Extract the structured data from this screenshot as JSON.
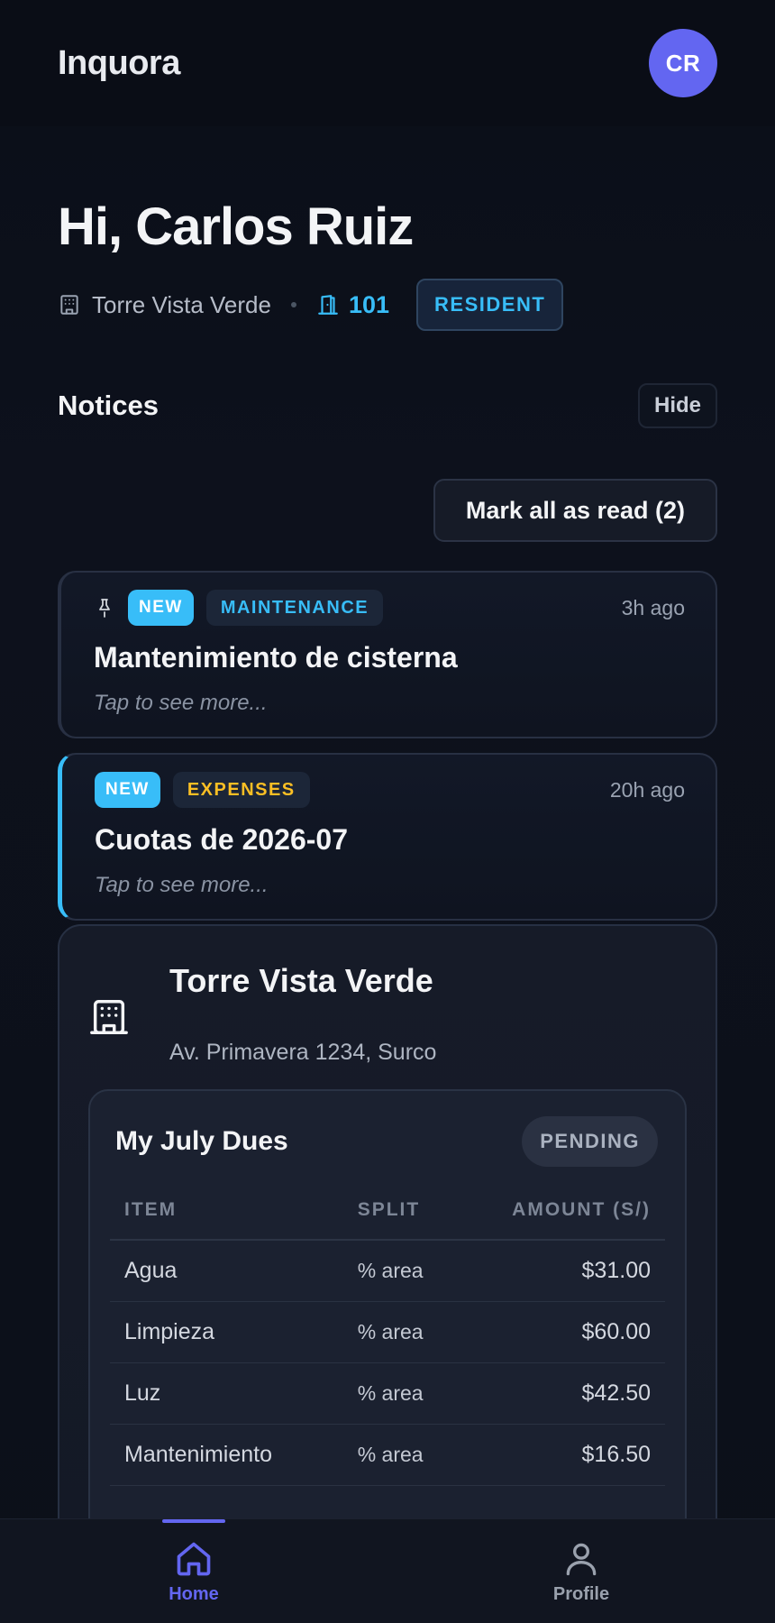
{
  "header": {
    "brand": "Inquora",
    "avatar_initials": "CR"
  },
  "greeting": {
    "title": "Hi, Carlos Ruiz",
    "building": "Torre Vista Verde",
    "unit": "101",
    "role": "RESIDENT"
  },
  "notices": {
    "title": "Notices",
    "hide_label": "Hide",
    "mark_all_label": "Mark all as read (2)",
    "items": [
      {
        "badge": "NEW",
        "category": "MAINTENANCE",
        "time": "3h ago",
        "title": "Mantenimiento de cisterna",
        "subtitle": "Tap to see more...",
        "pinned": true
      },
      {
        "badge": "NEW",
        "category": "EXPENSES",
        "time": "20h ago",
        "title": "Cuotas de 2026-07",
        "subtitle": "Tap to see more...",
        "pinned": false
      }
    ]
  },
  "building_card": {
    "name": "Torre Vista Verde",
    "address": "Av. Primavera 1234, Surco",
    "dues": {
      "title": "My July Dues",
      "status": "PENDING",
      "columns": [
        "ITEM",
        "SPLIT",
        "AMOUNT (S/)"
      ],
      "rows": [
        {
          "item": "Agua",
          "split": "% area",
          "amount": "$31.00"
        },
        {
          "item": "Limpieza",
          "split": "% area",
          "amount": "$60.00"
        },
        {
          "item": "Luz",
          "split": "% area",
          "amount": "$42.50"
        },
        {
          "item": "Mantenimiento",
          "split": "% area",
          "amount": "$16.50"
        }
      ]
    }
  },
  "bottom_nav": {
    "items": [
      {
        "label": "Home",
        "icon": "home-icon",
        "active": true
      },
      {
        "label": "Profile",
        "icon": "user-icon",
        "active": false
      }
    ]
  },
  "colors": {
    "accent": "#6366f1",
    "info": "#38bdf8",
    "warning": "#fbbf24",
    "background": "#0b0f19"
  }
}
